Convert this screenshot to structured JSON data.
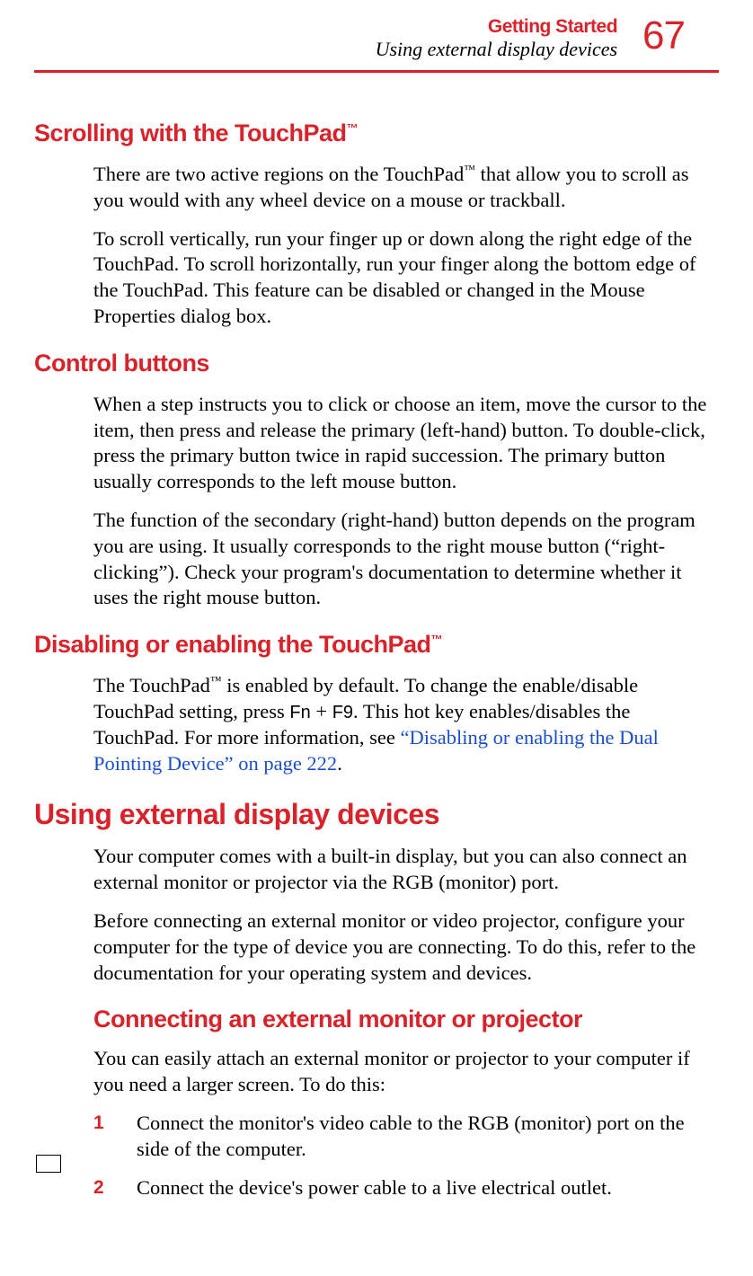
{
  "header": {
    "chapter": "Getting Started",
    "subtitle": "Using external display devices",
    "page_number": "67"
  },
  "section1": {
    "title_pre": "Scrolling with the TouchPad",
    "tm": "™",
    "p1_a": "There are two active regions on the TouchPad",
    "p1_tm": "™",
    "p1_b": " that allow you to scroll as you would with any wheel device on a mouse or trackball.",
    "p2": "To scroll vertically, run your finger up or down along the right edge of the TouchPad. To scroll horizontally, run your finger along the bottom edge of the TouchPad. This feature can be disabled or changed in the Mouse Properties dialog box."
  },
  "section2": {
    "title": "Control buttons",
    "p1": "When a step instructs you to click or choose an item, move the cursor to the item, then press and release the primary (left-hand) button. To double-click, press the primary button twice in rapid succession. The primary button usually corresponds to the left mouse button.",
    "p2": "The function of the secondary (right-hand) button depends on the program you are using. It usually corresponds to the right mouse button (“right-clicking”). Check your program's documentation to determine whether it uses the right mouse button."
  },
  "section3": {
    "title_pre": "Disabling or enabling the TouchPad",
    "tm": "™",
    "p1_a": "The TouchPad",
    "p1_tm": "™",
    "p1_b": " is enabled by default. To change the enable/disable TouchPad setting, press ",
    "p1_key1": "Fn",
    "p1_c": " + ",
    "p1_key2": "F9",
    "p1_d": ". This hot key enables/disables the TouchPad. For more information, see ",
    "p1_link": "“Disabling or enabling the Dual Pointing Device” on page 222",
    "p1_e": "."
  },
  "section4": {
    "title": "Using external display devices",
    "p1": "Your computer comes with a built-in display, but you can also connect an external monitor or projector via the RGB (monitor) port.",
    "p2": "Before connecting an external monitor or video projector, configure your computer for the type of device you are connecting. To do this, refer to the documentation for your operating system and devices."
  },
  "section5": {
    "title": "Connecting an external monitor or projector",
    "p1": "You can easily attach an external monitor or projector to your computer if you need a larger screen. To do this:",
    "steps": [
      {
        "num": "1",
        "text": "Connect the monitor's video cable to the RGB (monitor) port on the side of the computer."
      },
      {
        "num": "2",
        "text": "Connect the device's power cable to a live electrical outlet."
      }
    ]
  }
}
